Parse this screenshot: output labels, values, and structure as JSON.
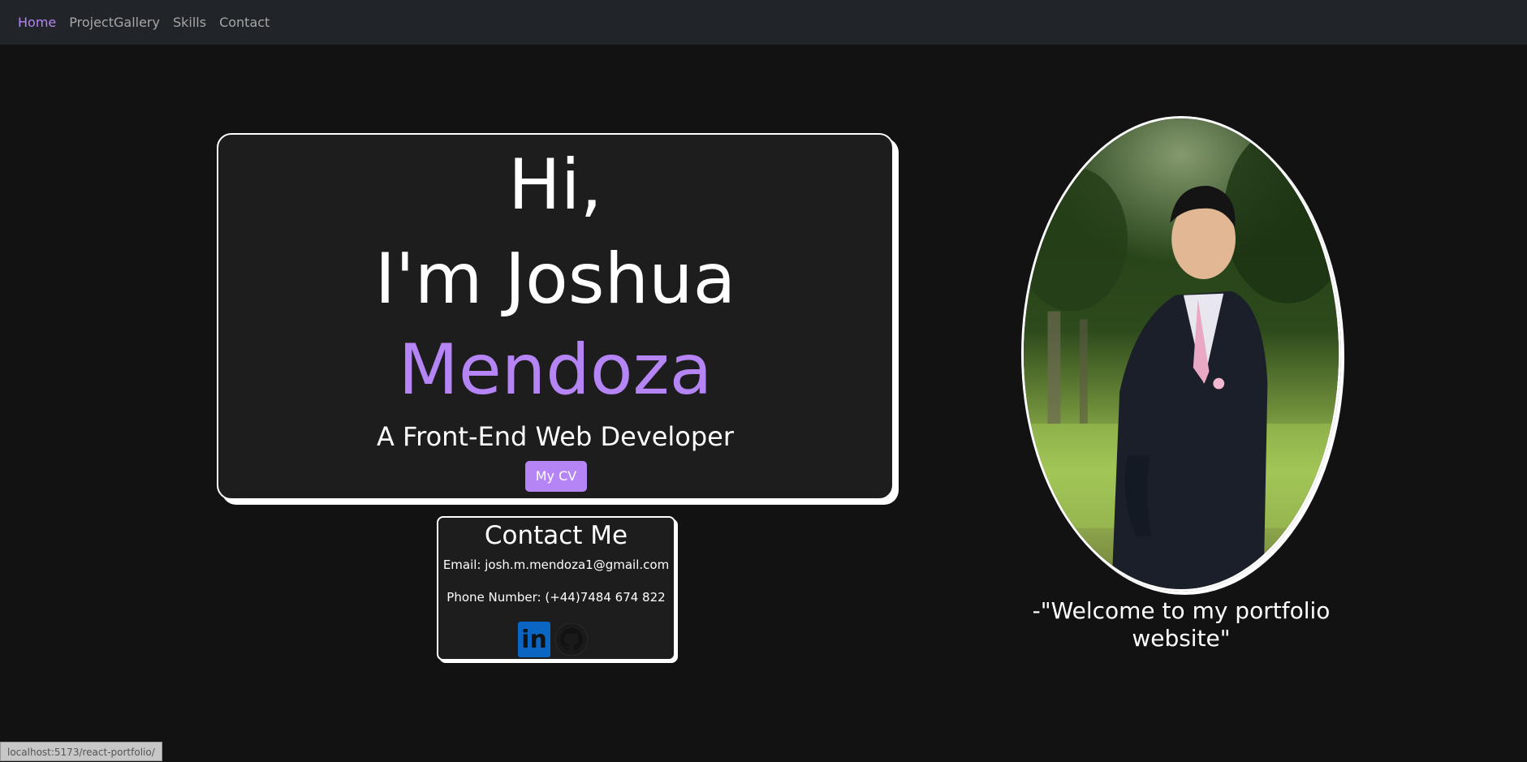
{
  "nav": {
    "items": [
      {
        "label": "Home",
        "active": true
      },
      {
        "label": "ProjectGallery",
        "active": false
      },
      {
        "label": "Skills",
        "active": false
      },
      {
        "label": "Contact",
        "active": false
      }
    ]
  },
  "hero": {
    "greeting": "Hi,",
    "name_line": "I'm Joshua",
    "surname": "Mendoza",
    "role": "A Front-End Web Developer",
    "cv_label": "My CV"
  },
  "contact": {
    "title": "Contact Me",
    "email": "Email: josh.m.mendoza1@gmail.com",
    "phone": "Phone Number: (+44)7484 674 822",
    "linkedin_glyph": "in"
  },
  "portrait": {
    "icon": "profile-photo"
  },
  "quote": "-\"Welcome to my portfolio website\"",
  "status_bar": "localhost:5173/react-portfolio/",
  "colors": {
    "accent": "#b584f5",
    "background": "#121212",
    "navbar": "#212529",
    "card": "#1d1d1d",
    "linkedin": "#0a66c2"
  }
}
